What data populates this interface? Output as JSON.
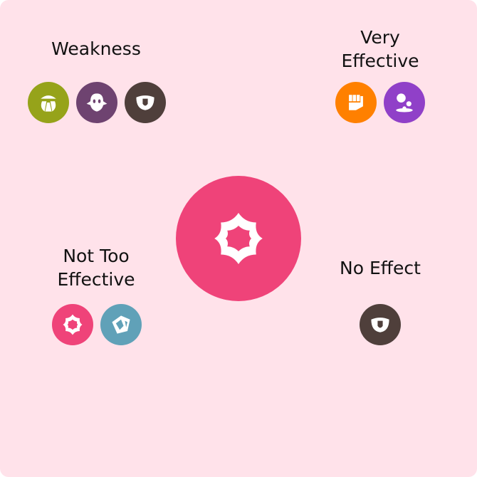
{
  "main_type": {
    "name": "psychic",
    "icon": "psychic-icon",
    "color": "#ef4379"
  },
  "sections": {
    "weakness": {
      "title": "Weakness",
      "types": [
        {
          "name": "bug",
          "icon": "bug-icon",
          "color": "#96a31a"
        },
        {
          "name": "ghost",
          "icon": "ghost-icon",
          "color": "#6e4370"
        },
        {
          "name": "dark",
          "icon": "dark-icon",
          "color": "#4f3f3b"
        }
      ]
    },
    "very_effective": {
      "title_line1": "Very",
      "title_line2": "Effective",
      "types": [
        {
          "name": "fighting",
          "icon": "fighting-icon",
          "color": "#ff8000"
        },
        {
          "name": "poison",
          "icon": "poison-icon",
          "color": "#9040c8"
        }
      ]
    },
    "not_too_effective": {
      "title_line1": "Not Too",
      "title_line2": "Effective",
      "types": [
        {
          "name": "psychic",
          "icon": "psychic-icon",
          "color": "#ef4379"
        },
        {
          "name": "steel",
          "icon": "steel-icon",
          "color": "#60a1b8"
        }
      ]
    },
    "no_effect": {
      "title": "No Effect",
      "types": [
        {
          "name": "dark",
          "icon": "dark-icon",
          "color": "#4f3f3b"
        }
      ]
    }
  }
}
